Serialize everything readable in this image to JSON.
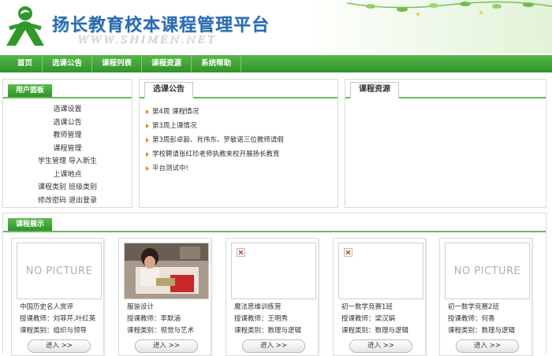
{
  "header": {
    "title": "扬长教育校本课程管理平台",
    "url_text": "WWW.SHIMEN.NET"
  },
  "nav": [
    "首页",
    "选课公告",
    "课程列表",
    "课程资源",
    "系统帮助"
  ],
  "user_panel": {
    "title": "用户面板",
    "rows": [
      [
        "选课设置"
      ],
      [
        "选课公告"
      ],
      [
        "教师管理"
      ],
      [
        "课程管理"
      ],
      [
        "学生管理",
        "导入新生"
      ],
      [
        "上课地点"
      ],
      [
        "课程类别",
        "班级类别"
      ],
      [
        "修改密码",
        "退出登录"
      ]
    ]
  },
  "notice_panel": {
    "title": "选课公告",
    "items": [
      "第4周 课程情况",
      "第3周上课情况",
      "第3周彭卓毅、肖伟东、罗敏诺三位教师请假",
      "学校聘请张红珍老师执教来校开展扬长教育",
      "平台测试中!"
    ]
  },
  "resource_panel": {
    "title": "课程资源"
  },
  "course_section": {
    "title": "课程展示"
  },
  "courses": [
    {
      "thumb": "nopic",
      "nopic_text": "NO PICTURE",
      "name": "中国历史名人赏评",
      "teacher": "授课教师：刘菲芹,叶红英",
      "category": "课程类别：组织与领导",
      "button": "进入 >>"
    },
    {
      "thumb": "photo",
      "name": "服装设计",
      "teacher": "授课教师：李默涵",
      "category": "课程类别：视觉与艺术",
      "button": "进入 >>"
    },
    {
      "thumb": "broken",
      "name": "魔法思维训练营",
      "teacher": "授课教师：王明秀",
      "category": "课程类别：数理与逻辑",
      "button": "进入 >>"
    },
    {
      "thumb": "broken",
      "name": "初一数学竞赛1班",
      "teacher": "授课教师：梁汉娟",
      "category": "课程类别：数理与逻辑",
      "button": "进入 >>"
    },
    {
      "thumb": "nopic",
      "nopic_text": "NO PICTURE",
      "name": "初一数学竞赛2班",
      "teacher": "授课教师：何香",
      "category": "课程类别：数理与逻辑",
      "button": "进入 >>"
    }
  ],
  "colors": {
    "nav": "#3da234",
    "title": "#2a6ab0",
    "accent": "#e08a1a"
  },
  "icons": {
    "logo": "person-logo-icon",
    "bullet": "orange-arrow-icon",
    "broken_image": "broken-image-icon"
  }
}
